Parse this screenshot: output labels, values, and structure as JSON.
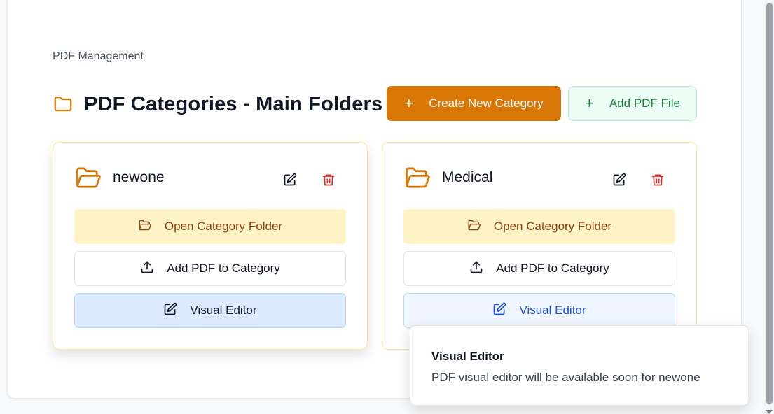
{
  "header": {
    "section_label": "PDF Management",
    "title": "PDF Categories - Main Folders",
    "create_button": "Create New Category",
    "add_pdf_button": "Add PDF File"
  },
  "categories": [
    {
      "name": "newone",
      "open_label": "Open Category Folder",
      "add_label": "Add PDF to Category",
      "visual_label": "Visual Editor"
    },
    {
      "name": "Medical",
      "open_label": "Open Category Folder",
      "add_label": "Add PDF to Category",
      "visual_label": "Visual Editor"
    }
  ],
  "toast": {
    "title": "Visual Editor",
    "description": "PDF visual editor will be available soon for newone"
  },
  "colors": {
    "accent": "#d97706",
    "success": "#15803d",
    "danger": "#dc2626",
    "info": "#1d4ed8"
  },
  "icons": [
    "folder-icon",
    "plus-icon",
    "edit-icon",
    "trash-icon",
    "folder-open-icon",
    "upload-icon"
  ]
}
